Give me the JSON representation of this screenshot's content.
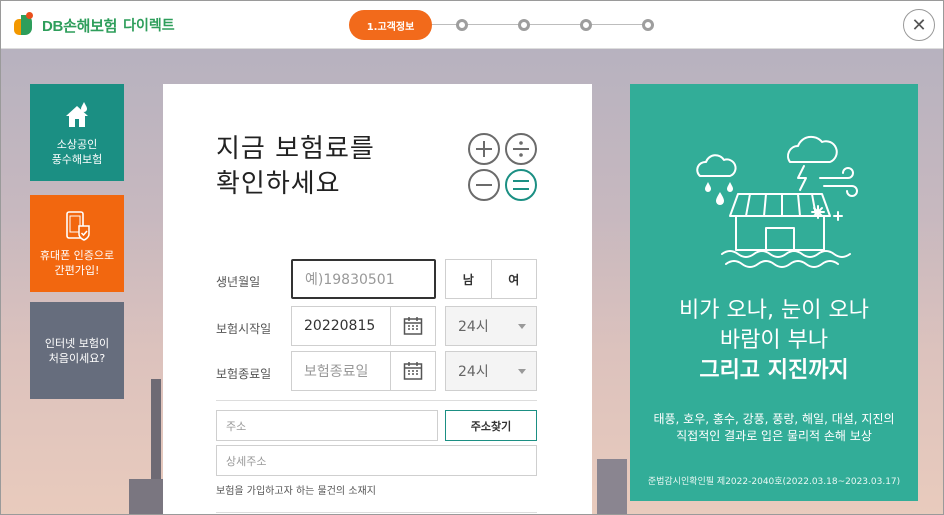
{
  "header": {
    "brand": "DB손해보험",
    "brand_sub": "다이렉트",
    "step_active_label": "1.고객정보",
    "close_symbol": "✕"
  },
  "side": {
    "items": [
      {
        "label_line1": "소상공인",
        "label_line2": "풍수해보험",
        "icon": "house-water-icon"
      },
      {
        "label_line1": "휴대폰 인증으로",
        "label_line2": "간편가입!",
        "icon": "phone-check-icon"
      },
      {
        "label_line1": "인터넷 보험이",
        "label_line2": "처음이세요?"
      }
    ]
  },
  "form": {
    "title_line1": "지금 보험료를",
    "title_line2": "확인하세요",
    "birth": {
      "label": "생년월일",
      "placeholder": "예)19830501"
    },
    "gender": {
      "male": "남",
      "female": "여"
    },
    "start": {
      "label": "보험시작일",
      "value": "20220815",
      "time": "24시"
    },
    "end": {
      "label": "보험종료일",
      "placeholder": "보험종료일",
      "time": "24시"
    },
    "address": {
      "placeholder": "주소",
      "detail_placeholder": "상세주소",
      "search_button": "주소찾기",
      "hint": "보험을 가입하고자 하는 물건의 소재지"
    }
  },
  "promo": {
    "line1": "비가 오나, 눈이 오나",
    "line2": "바람이 부나",
    "line3": "그리고 지진까지",
    "desc_line1": "태풍, 호우, 홍수, 강풍, 풍랑, 해일, 대설, 지진의",
    "desc_line2": "직접적인 결과로 입은 물리적 손해 보상",
    "legal": "준법감시인확인필 제2022-2040호(2022.03.18~2023.03.17)"
  },
  "colors": {
    "accent_orange": "#f26a1b",
    "teal": "#1b8f83",
    "promo_green": "#32ad98",
    "gray_button": "#666d7d"
  }
}
